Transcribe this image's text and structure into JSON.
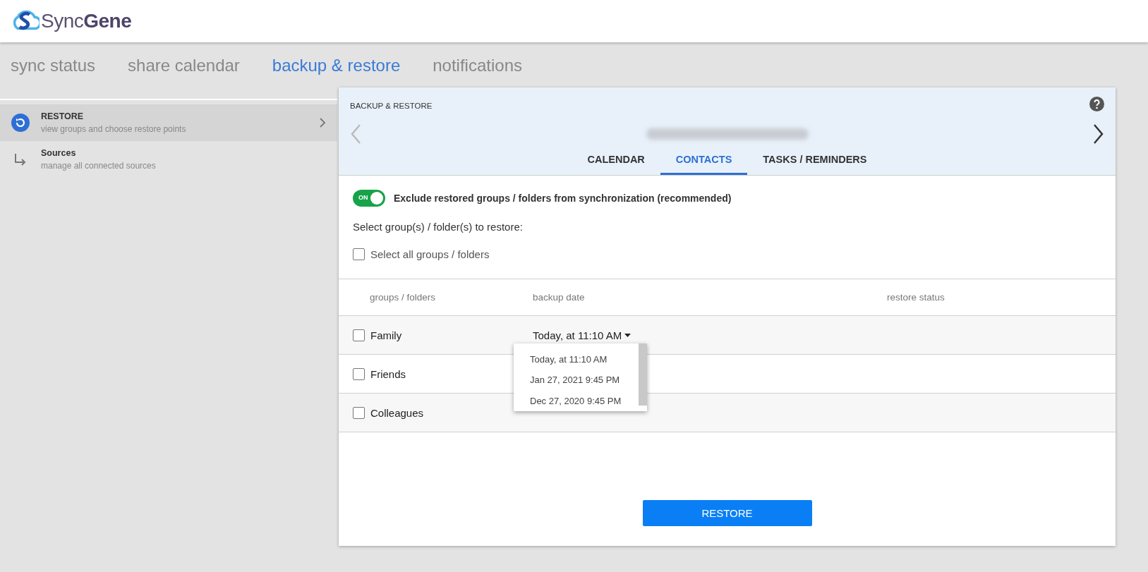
{
  "header": {
    "logo_text": "Sync**Gene**"
  },
  "nav": [
    {
      "label": "sync status",
      "selected": false
    },
    {
      "label": "share calendar",
      "selected": false
    },
    {
      "label": "backup & restore",
      "selected": true
    },
    {
      "label": "notifications",
      "selected": false
    }
  ],
  "sidebar": {
    "items": [
      {
        "kind": "restore",
        "title": "RESTORE",
        "subtitle": "view groups and choose restore points",
        "selected": true
      },
      {
        "kind": "sources",
        "title": "Sources",
        "subtitle": "manage all connected sources",
        "selected": false
      }
    ]
  },
  "panel": {
    "title": "BACKUP & RESTORE",
    "tabs": [
      {
        "label": "CALENDAR",
        "selected": false
      },
      {
        "label": "CONTACTS",
        "selected": true
      },
      {
        "label": "TASKS / REMINDERS",
        "selected": false
      }
    ],
    "exclude_toggle": {
      "on": true,
      "state_label": "ON",
      "label": "Exclude restored groups / folders from synchronization (recommended)"
    },
    "select_prompt": "Select group(s) / folder(s) to restore:",
    "select_all": {
      "label": "Select all groups / folders",
      "checked": false
    },
    "table": {
      "columns": [
        "groups / folders",
        "backup date",
        "restore status"
      ],
      "rows": [
        {
          "name": "Family",
          "checked": false,
          "backup_date": "Today, at 11:10 AM"
        },
        {
          "name": "Friends",
          "checked": false
        },
        {
          "name": "Colleagues",
          "checked": false
        }
      ]
    },
    "date_dropdown": {
      "options": [
        "Today, at 11:10 AM",
        "Jan 27, 2021 9:45 PM",
        "Dec 27, 2020 9:45 PM"
      ]
    },
    "restore_button": "RESTORE"
  }
}
